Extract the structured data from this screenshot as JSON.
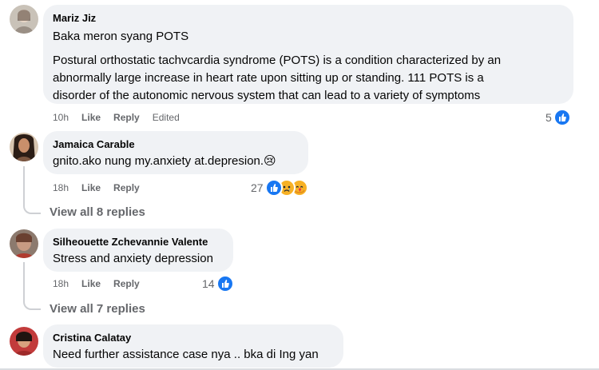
{
  "comments": [
    {
      "author": "Mariz Jiz",
      "lines": [
        "Baka meron syang POTS",
        "Postural orthostatic tachvcardia syndrome (POTS) is a condition characterized by an",
        "abnormally large increase in heart rate upon sitting up or standing. 111 POTS is a",
        "disorder of the autonomic nervous system that can lead to a variety of symptoms"
      ],
      "time": "10h",
      "like": "Like",
      "reply": "Reply",
      "edited": "Edited",
      "reactions_count": "5",
      "reaction_icons": [
        "like-icon"
      ]
    },
    {
      "author": "Jamaica Carable",
      "text": "gnito.ako nung my.anxiety at.depresion.😢",
      "time": "18h",
      "like": "Like",
      "reply": "Reply",
      "reactions_count": "27",
      "reaction_icons": [
        "like-icon",
        "sad-icon",
        "care-icon"
      ],
      "view_replies": "View all 8 replies"
    },
    {
      "author": "Silheouette Zchevannie Valente",
      "text": "Stress and anxiety depression",
      "time": "18h",
      "like": "Like",
      "reply": "Reply",
      "reactions_count": "14",
      "reaction_icons": [
        "like-icon"
      ],
      "view_replies": "View all 7 replies"
    },
    {
      "author": "Cristina Calatay",
      "text": "Need further assistance case nya .. bka di Ing yan"
    }
  ],
  "colors": {
    "bubble": "#f0f2f5",
    "meta": "#65676b",
    "like_blue": "#1877f2",
    "emoji_yellow": "#f7b125"
  }
}
